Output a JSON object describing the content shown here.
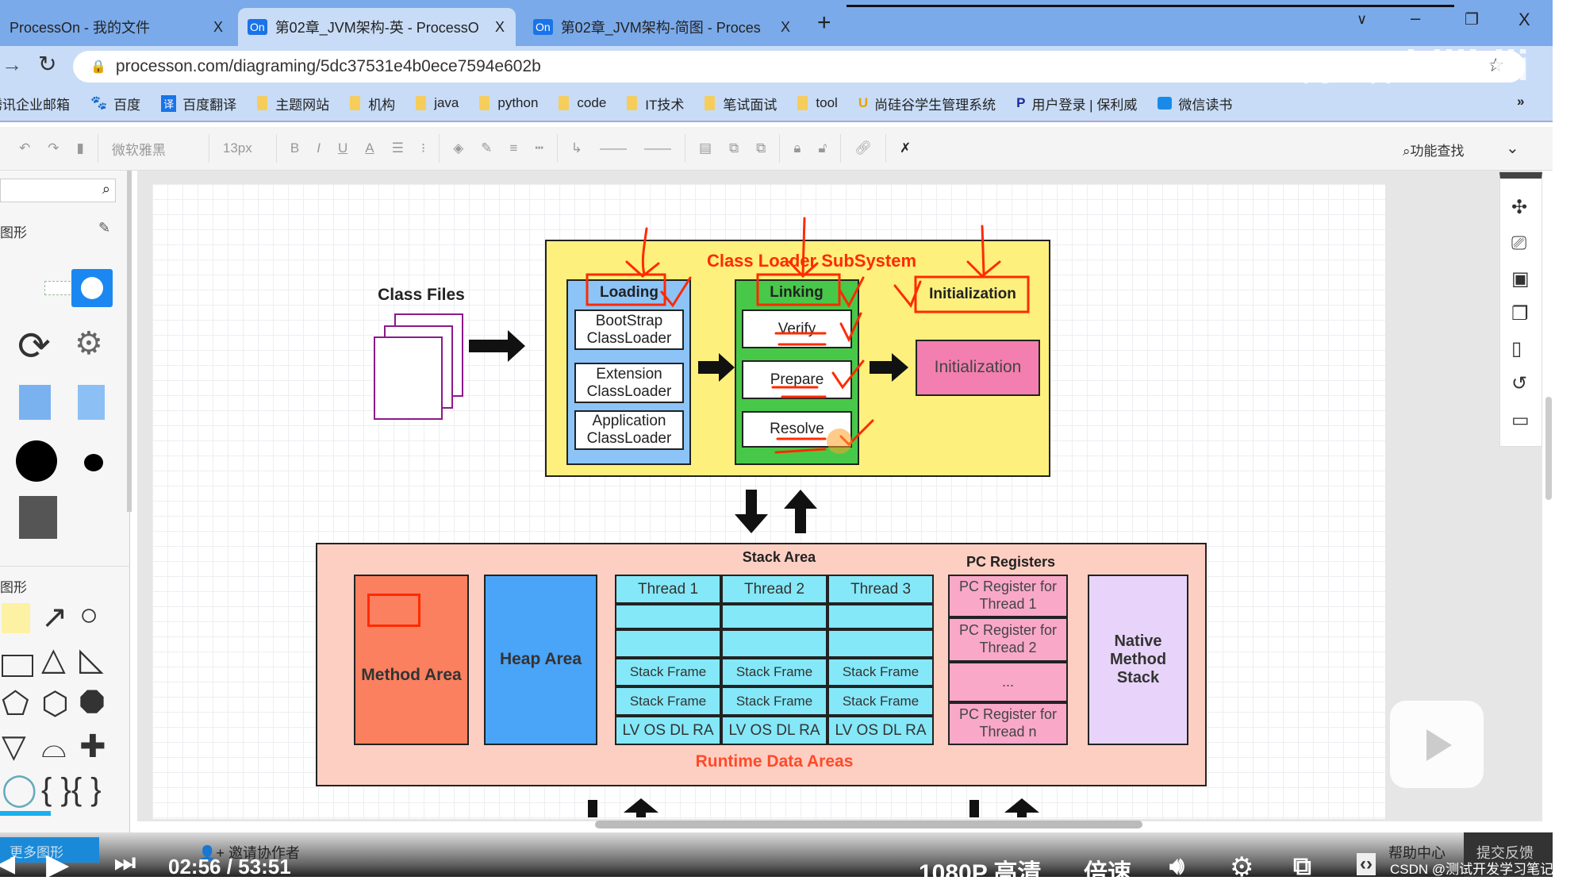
{
  "browser": {
    "tabs": [
      {
        "label": "ProcessOn - 我的文件",
        "close": "X"
      },
      {
        "label": "第02章_JVM架构-英 - ProcessO",
        "close": "X",
        "badge": "On"
      },
      {
        "label": "第02章_JVM架构-简图 - Proces",
        "close": "X",
        "badge": "On"
      }
    ],
    "new_tab": "+",
    "window_controls": [
      "∨",
      "–",
      "❐",
      "X"
    ],
    "url": "processon.com/diagraming/5dc37531e4b0ece7594e602b",
    "bookmarks": [
      "腾讯企业邮箱",
      "百度",
      "百度翻译",
      "主题网站",
      "机构",
      "java",
      "python",
      "code",
      "IT技术",
      "笔试面试",
      "tool",
      "尚硅谷学生管理系统",
      "用户登录 | 保利威",
      "微信读书"
    ],
    "more_bookmarks": "»",
    "watermark": "尚硅谷 bilibili"
  },
  "toolbar": {
    "font": "微软雅黑",
    "size": "13px",
    "search": "功能查找",
    "buttons": [
      "undo",
      "redo",
      "format-painter",
      "bold",
      "italic",
      "underline",
      "font-color",
      "align",
      "list",
      "fill",
      "line-color",
      "line-weight",
      "dash",
      "connector",
      "line-start",
      "line-end",
      "arrange",
      "front",
      "back",
      "lock",
      "unlock",
      "link",
      "magic"
    ],
    "labels": {
      "bold": "B",
      "italic": "I",
      "underline": "U",
      "color": "A"
    }
  },
  "left_panel": {
    "section1": "图形",
    "section2": "图形",
    "more_shapes": "更多图形"
  },
  "diagram": {
    "class_files": "Class Files",
    "subsystem_title": "Class Loader SubSystem",
    "loading": {
      "title": "Loading",
      "items": [
        "BootStrap ClassLoader",
        "Extension ClassLoader",
        "Application ClassLoader"
      ]
    },
    "linking": {
      "title": "Linking",
      "items": [
        "Verify",
        "Prepare",
        "Resolve"
      ]
    },
    "initialization_title": "Initialization",
    "initialization_box": "Initialization",
    "runtime_title": "Runtime Data Areas",
    "method_area": "Method Area",
    "heap_area": "Heap Area",
    "stack_area": {
      "title": "Stack Area",
      "threads": [
        "Thread 1",
        "Thread 2",
        "Thread 3"
      ],
      "frame": "Stack Frame",
      "locals": "LV OS DL RA"
    },
    "pc_registers": {
      "title": "PC Registers",
      "items": [
        "PC Register for Thread 1",
        "PC Register for Thread 2",
        "...",
        "PC Register for Thread n"
      ]
    },
    "native_stack": "Native Method Stack",
    "colors": {
      "subsystem": "#fdf07d",
      "loading": "#8cc4f8",
      "linking": "#48c848",
      "init": "#f27fb0",
      "runtime": "#fdcfc2",
      "method": "#fa8060",
      "heap": "#4aa4f8",
      "stack": "#84e8f8",
      "pc": "#f9a8c8",
      "native": "#e8d4fa",
      "annotation": "#ff2a00"
    }
  },
  "footer": {
    "invite": "邀请协作者",
    "help": "帮助中心",
    "feedback": "提交反馈"
  },
  "video": {
    "time": "02:56 / 53:51",
    "quality": "1080P 高清",
    "speed": "倍速",
    "credit": "CSDN @测试开发学习笔记"
  }
}
